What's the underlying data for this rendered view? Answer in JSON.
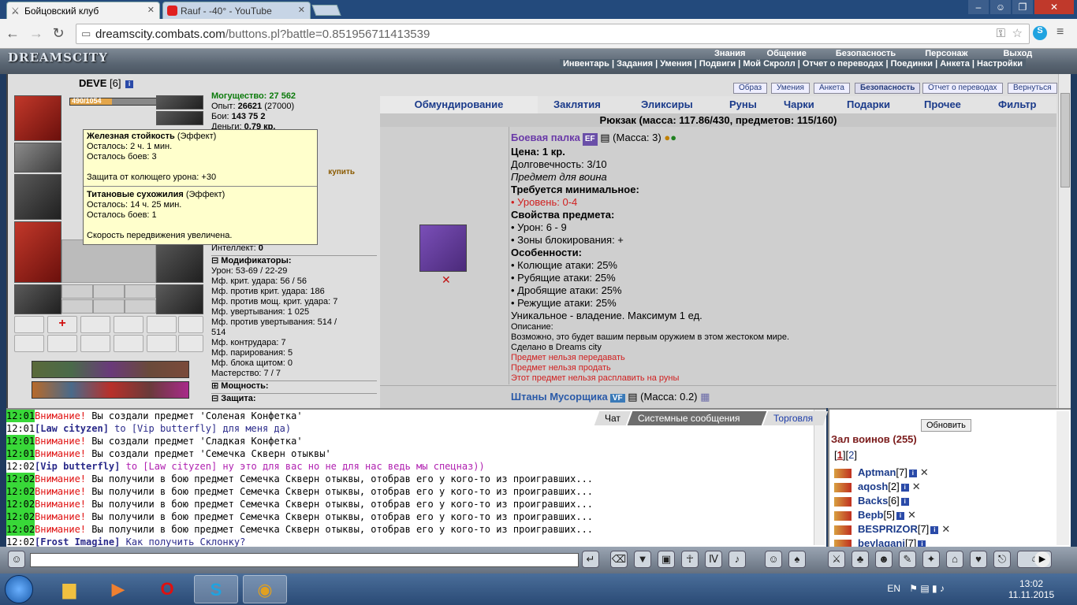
{
  "browser": {
    "tabs": [
      {
        "title": "Бойцовский клуб",
        "active": true
      },
      {
        "title": "Rauf - -40° - YouTube",
        "active": false
      }
    ],
    "url_host": "dreamscity.combats.com",
    "url_path": "/buttons.pl?battle=0.851956711413539"
  },
  "game": {
    "logo": "DREAMSCITY",
    "top_menu": [
      "Знания",
      "Общение",
      "Безопасность",
      "Персонаж",
      "Выход"
    ],
    "sub_menu": [
      "Инвентарь",
      "Задания",
      "Умения",
      "Подвиги",
      "Мой Скролл",
      "Отчет о переводах",
      "Поединки",
      "Анкета",
      "Настройки"
    ],
    "character": {
      "name": "DEVE",
      "level": "[6]",
      "hp": "490/1054",
      "hp_fraction": 0.46
    },
    "stats": {
      "power_label": "Могущество:",
      "power": "27 562",
      "exp_label": "Опыт:",
      "exp": "26621",
      "exp_next": "(27000)",
      "fights_label": "Бои:",
      "fights": "143",
      "fights_win": "75",
      "fights_draw": "2",
      "money_label": "Деньги:",
      "money": "0.79 кр.",
      "buy": "купить",
      "intellect_label": "Интеллект:",
      "intellect": "0",
      "modifiers_title": "Модификаторы:",
      "modifiers": [
        "Урон: 53-69 / 22-29",
        "Мф. крит. удара: 56 / 56",
        "Мф. против крит. удара: 186",
        "Мф. против мощ. крит. удара: 7",
        "Мф. увертывания: 1 025",
        "Мф. против увертывания: 514 /",
        "514",
        "Мф. контрудара: 7",
        "Мф. парирования: 5",
        "Мф. блока щитом: 0",
        "Мастерство: 7 / 7"
      ],
      "power_section": "Мощность:",
      "defense_section": "Защита:"
    },
    "tooltip": {
      "effect1_name": "Железная стойкость",
      "effect_tag": "(Эффект)",
      "effect1_time": "Осталось: 2 ч. 1 мин.",
      "effect1_fights": "Осталось боев: 3",
      "effect1_desc": "Защита от колющего урона: +30",
      "effect2_name": "Титановые сухожилия",
      "effect2_time": "Осталось: 14 ч. 25 мин.",
      "effect2_fights": "Осталось боев: 1",
      "effect2_desc": "Скорость передвижения увеличена."
    },
    "small_buttons": [
      "Образ",
      "Умения",
      "Анкета",
      "Безопасность",
      "Отчет о переводах",
      "Вернуться"
    ],
    "inventory_tabs": [
      "Обмундирование",
      "Заклятия",
      "Эликсиры",
      "Руны",
      "Чарки",
      "Подарки",
      "Прочее",
      "Фильтр"
    ],
    "backpack": "Рюкзак (масса: 117.86/430, предметов: 115/160)",
    "item": {
      "name": "Боевая палка",
      "badge": "EF",
      "mass": "(Масса: 3)",
      "price": "Цена: 1 кр.",
      "durability": "Долговечность: 3/10",
      "for": "Предмет для воина",
      "req_title": "Требуется минимальное:",
      "req_level": "• Уровень: 0-4",
      "props_title": "Свойства предмета:",
      "damage": "• Урон: 6 - 9",
      "zones": "• Зоны блокирования: +",
      "features_title": "Особенности:",
      "f1": "• Колющие атаки: 25%",
      "f2": "• Рубящие атаки: 25%",
      "f3": "• Дробящие атаки: 25%",
      "f4": "• Режущие атаки: 25%",
      "unique": "Уникальное - владение. Максимум 1 ед.",
      "desc_title": "Описание:",
      "desc": "Возможно, это будет вашим первым оружием в этом жестоком мире.",
      "made": "Сделано в Dreams city",
      "no_transfer": "Предмет нельзя передавать",
      "no_sell": "Предмет нельзя продать",
      "no_runes": "Этот предмет нельзя расплавить на руны"
    },
    "item2": {
      "name": "Штаны Мусорщика",
      "badge": "VF",
      "mass": "(Масса: 0.2)"
    }
  },
  "chat": {
    "tabs": [
      "Чат",
      "Системные сообщения",
      "Торговля"
    ],
    "lines": [
      {
        "ts": "12:01",
        "green": true,
        "warn": "Внимание!",
        "text": " Вы создали предмет 'Соленая Конфетка'"
      },
      {
        "ts": "12:01",
        "green": false,
        "from": "[Law cityzen]",
        "text": " to [Vip butterfly] для меня да)"
      },
      {
        "ts": "12:01",
        "green": true,
        "warn": "Внимание!",
        "text": " Вы создали предмет 'Сладкая Конфетка'"
      },
      {
        "ts": "12:01",
        "green": true,
        "warn": "Внимание!",
        "text": " Вы создали предмет 'Семечка Скверн отыквы'"
      },
      {
        "ts": "12:02",
        "green": false,
        "from": "[Vip butterfly]",
        "text": " to [Law cityzen] ну это для вас но не для нас ведь мы спецназ))"
      },
      {
        "ts": "12:02",
        "green": true,
        "warn": "Внимание!",
        "text": " Вы получили в бою предмет Семечка Скверн отыквы, отобрав его у кого-то из проигравших..."
      },
      {
        "ts": "12:02",
        "green": true,
        "warn": "Внимание!",
        "text": " Вы получили в бою предмет Семечка Скверн отыквы, отобрав его у кого-то из проигравших..."
      },
      {
        "ts": "12:02",
        "green": true,
        "warn": "Внимание!",
        "text": " Вы получили в бою предмет Семечка Скверн отыквы, отобрав его у кого-то из проигравших..."
      },
      {
        "ts": "12:02",
        "green": true,
        "warn": "Внимание!",
        "text": " Вы получили в бою предмет Семечка Скверн отыквы, отобрав его у кого-то из проигравших..."
      },
      {
        "ts": "12:02",
        "green": true,
        "warn": "Внимание!",
        "text": " Вы получили в бою предмет Семечка Скверн отыквы, отобрав его у кого-то из проигравших..."
      },
      {
        "ts": "12:02",
        "green": false,
        "from": "[Frost Imagine]",
        "text": " Как получить Склонку?"
      }
    ]
  },
  "side": {
    "refresh": "Обновить",
    "title": "Зал воинов (255)",
    "page1": "1",
    "page2": "2",
    "players": [
      {
        "name": "Aptman",
        "level": "[7]"
      },
      {
        "name": "aqosh",
        "level": "[2]"
      },
      {
        "name": "Backs",
        "level": "[6]"
      },
      {
        "name": "Bepb",
        "level": "[5]"
      },
      {
        "name": "BESPRIZOR",
        "level": "[7]"
      },
      {
        "name": "beylaqani",
        "level": "[7]"
      }
    ]
  },
  "taskbar": {
    "lang": "EN",
    "time": "13:02",
    "date": "11.11.2015"
  }
}
